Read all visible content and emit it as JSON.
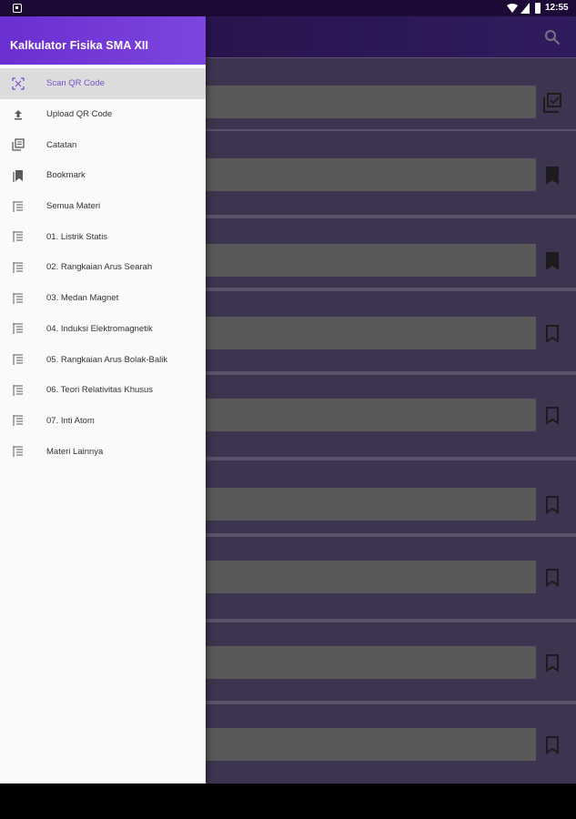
{
  "status_bar": {
    "time": "12:55",
    "icons": [
      "notification-icon",
      "wifi-icon",
      "signal-icon",
      "battery-icon"
    ]
  },
  "app": {
    "title": "Kalkulator Fisika SMA XII",
    "card_icons": [
      "library-check-icon",
      "bookmark-filled-icon",
      "bookmark-filled-icon",
      "bookmark-outline-icon",
      "bookmark-outline-icon",
      "bookmark-outline-icon",
      "bookmark-outline-icon",
      "bookmark-outline-icon",
      "bookmark-outline-icon"
    ]
  },
  "drawer": {
    "title": "Kalkulator Fisika SMA XII",
    "items": [
      {
        "label": "Scan QR Code",
        "icon": "qr-scan-icon",
        "active": true
      },
      {
        "label": "Upload QR Code",
        "icon": "upload-icon",
        "active": false
      },
      {
        "label": "Catatan",
        "icon": "notes-icon",
        "active": false
      },
      {
        "label": "Bookmark",
        "icon": "bookmarks-icon",
        "active": false
      },
      {
        "label": "Semua Materi",
        "icon": "list-icon",
        "active": false
      },
      {
        "label": "01. Listrik Statis",
        "icon": "list-icon",
        "active": false
      },
      {
        "label": "02. Rangkaian Arus Searah",
        "icon": "list-icon",
        "active": false
      },
      {
        "label": "03. Medan Magnet",
        "icon": "list-icon",
        "active": false
      },
      {
        "label": "04. Induksi Elektromagnetik",
        "icon": "list-icon",
        "active": false
      },
      {
        "label": "05. Rangkaian Arus Bolak-Balik",
        "icon": "list-icon",
        "active": false
      },
      {
        "label": "06. Teori Relativitas Khusus",
        "icon": "list-icon",
        "active": false
      },
      {
        "label": "07. Inti Atom",
        "icon": "list-icon",
        "active": false
      },
      {
        "label": "Materi Lainnya",
        "icon": "list-icon",
        "active": false
      }
    ]
  },
  "colors": {
    "accent": "#7b4fcf",
    "header_start": "#6a2fd0",
    "appbar": "#3a1a6e"
  }
}
